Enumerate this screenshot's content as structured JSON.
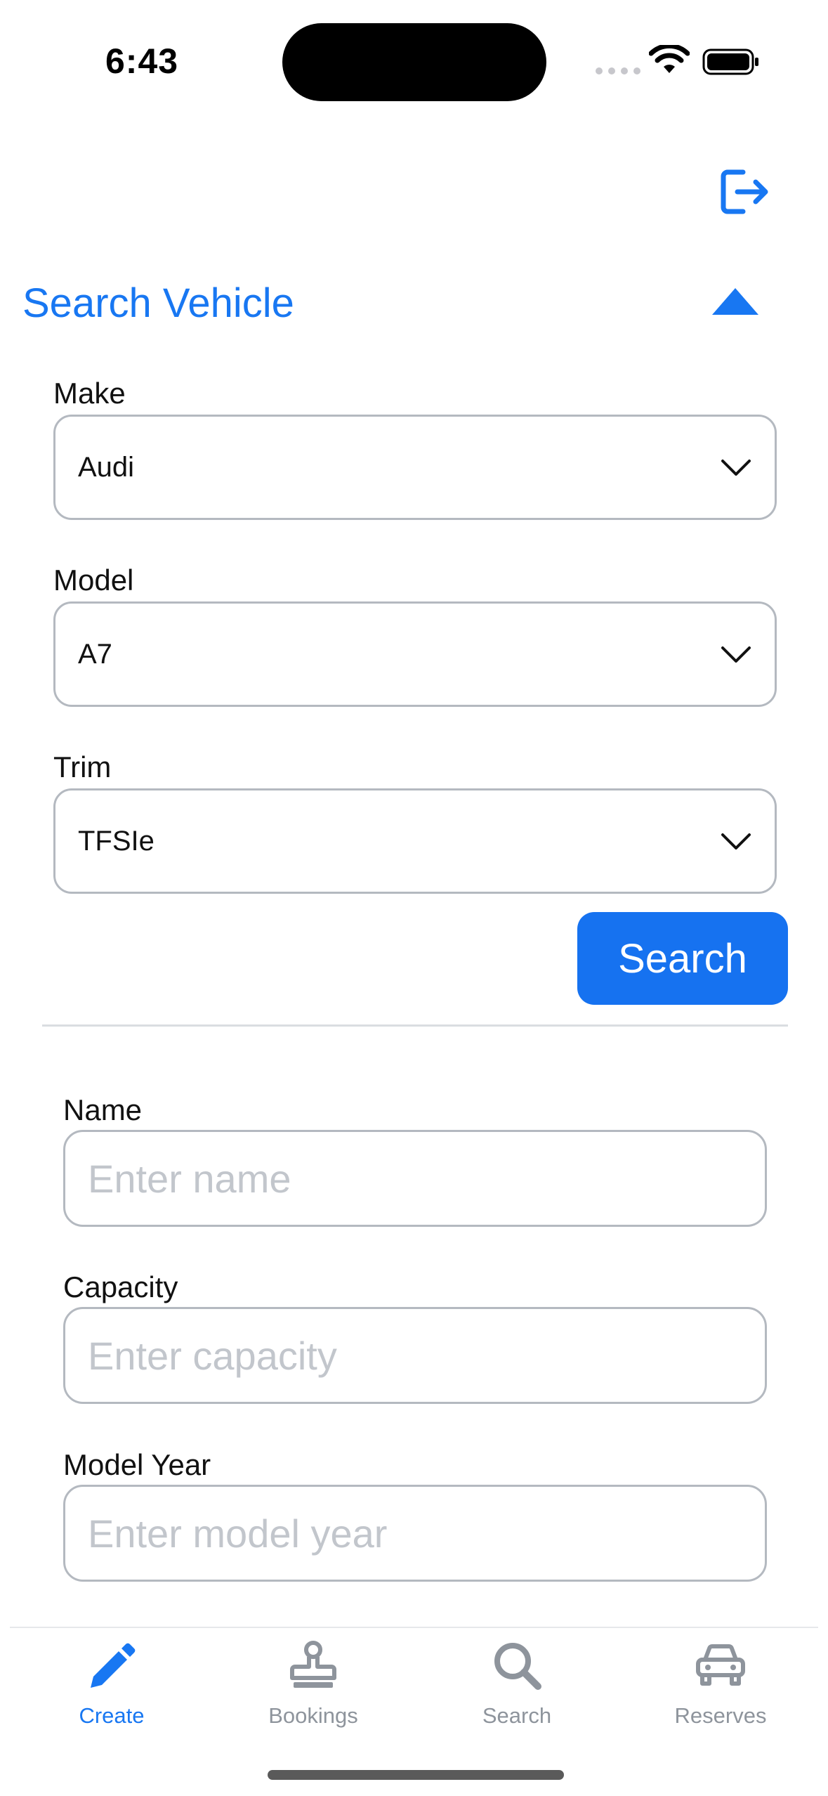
{
  "status_bar": {
    "time": "6:43"
  },
  "header": {
    "logout_icon": "logout-icon"
  },
  "search_vehicle": {
    "title": "Search Vehicle",
    "make": {
      "label": "Make",
      "value": "Audi"
    },
    "model": {
      "label": "Model",
      "value": "A7"
    },
    "trim": {
      "label": "Trim",
      "value": "TFSIe"
    },
    "search_button": "Search"
  },
  "form": {
    "name": {
      "label": "Name",
      "placeholder": "Enter name",
      "value": ""
    },
    "capacity": {
      "label": "Capacity",
      "placeholder": "Enter capacity",
      "value": ""
    },
    "model_year": {
      "label": "Model Year",
      "placeholder": "Enter model year",
      "value": ""
    }
  },
  "tabs": [
    {
      "label": "Create",
      "icon": "pencil-icon",
      "active": true
    },
    {
      "label": "Bookings",
      "icon": "stamp-icon",
      "active": false
    },
    {
      "label": "Search",
      "icon": "search-icon",
      "active": false
    },
    {
      "label": "Reserves",
      "icon": "car-icon",
      "active": false
    }
  ],
  "colors": {
    "accent": "#1877f2",
    "button": "#1672f0",
    "inactive": "#8e949c",
    "border": "#b4b9c0"
  }
}
